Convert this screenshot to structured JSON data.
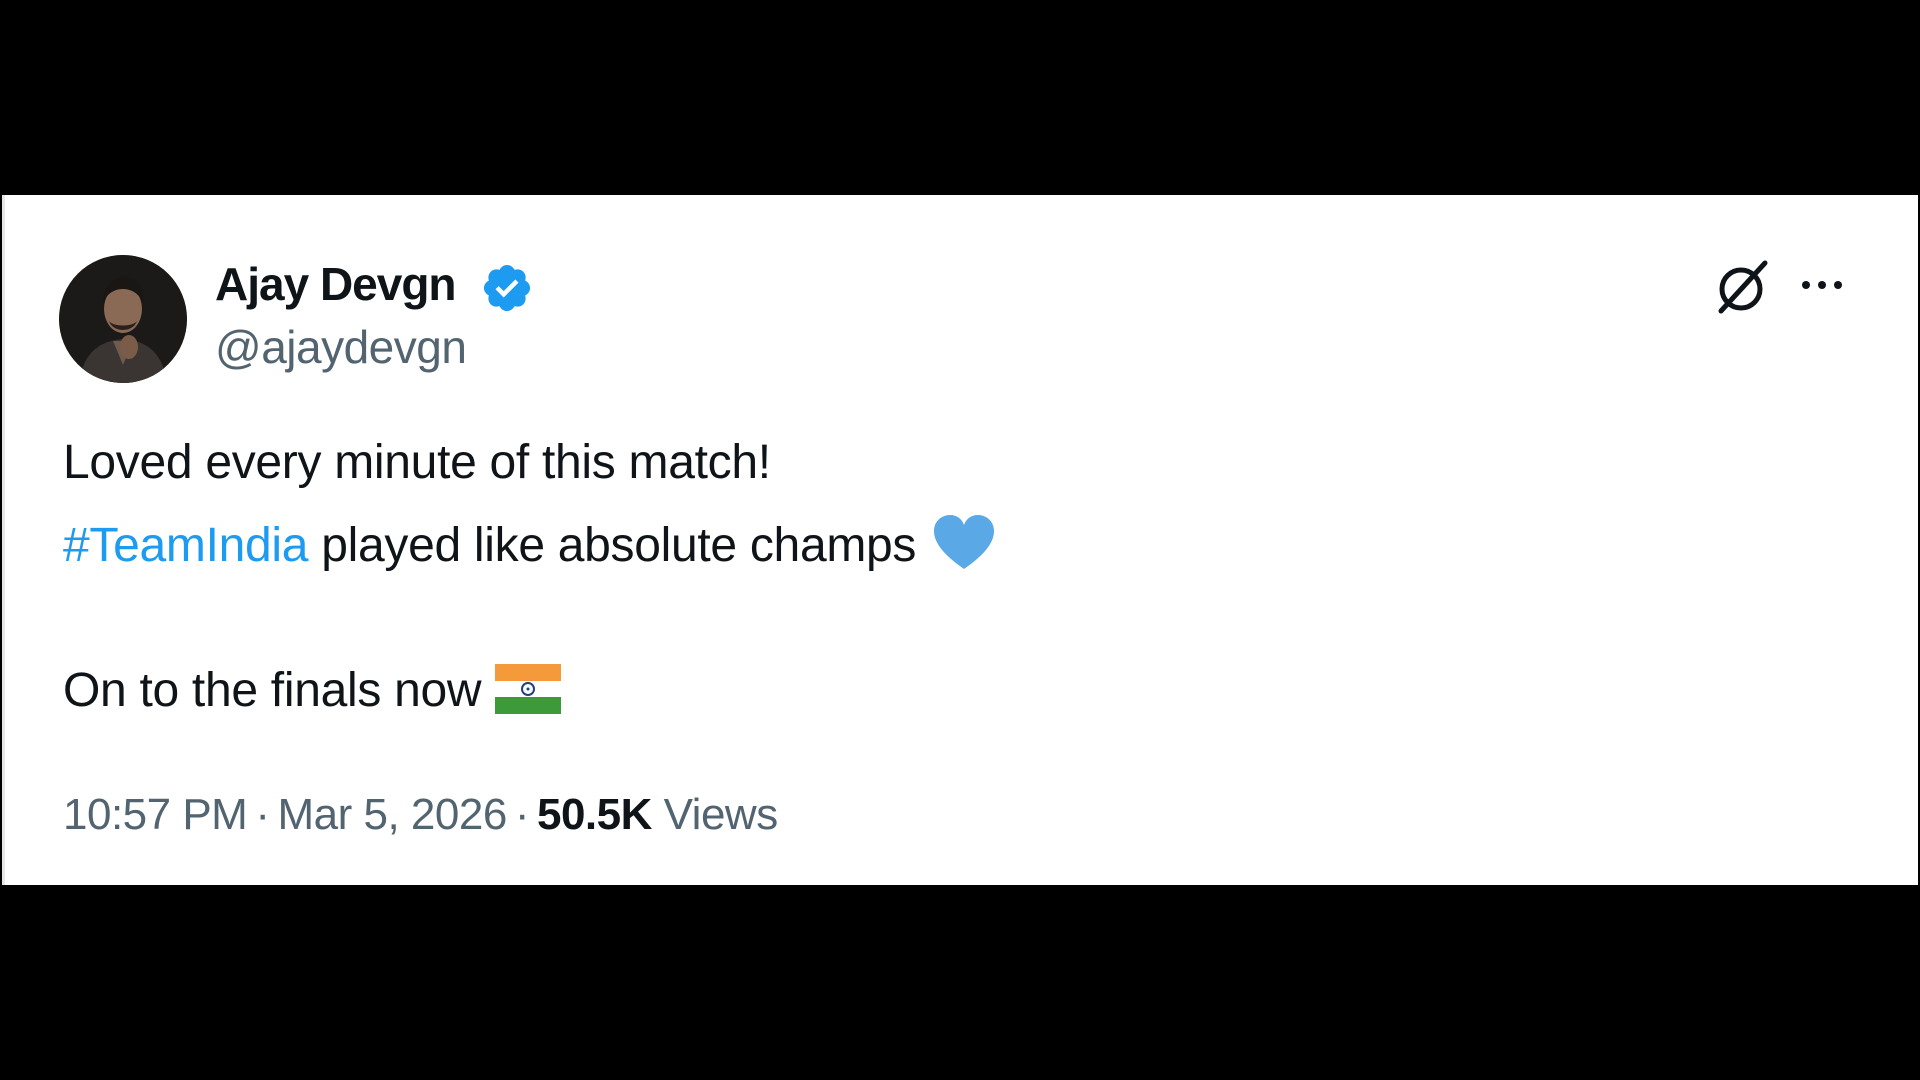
{
  "tweet": {
    "author": {
      "name": "Ajay Devgn",
      "handle": "@ajaydevgn",
      "verified": true
    },
    "body": {
      "line1": "Loved every minute of this match!",
      "line2_hashtag": "#TeamIndia",
      "line2_text": " played like absolute champs",
      "line2_emoji": "blue-heart",
      "line3_text": "On to the finals now",
      "line3_emoji": "flag-india"
    },
    "meta": {
      "time": "10:57 PM",
      "separator": "·",
      "date": "Mar 5, 2026",
      "views_count": "50.5K",
      "views_label": "Views"
    },
    "icons": {
      "grok": "grok-icon",
      "more": "more-options-icon",
      "verified": "verified-badge-icon"
    }
  },
  "colors": {
    "background": "#000000",
    "card": "#ffffff",
    "text_primary": "#0f1419",
    "text_secondary": "#536471",
    "accent": "#1d9bf0",
    "heart": "#5aa9e6"
  }
}
